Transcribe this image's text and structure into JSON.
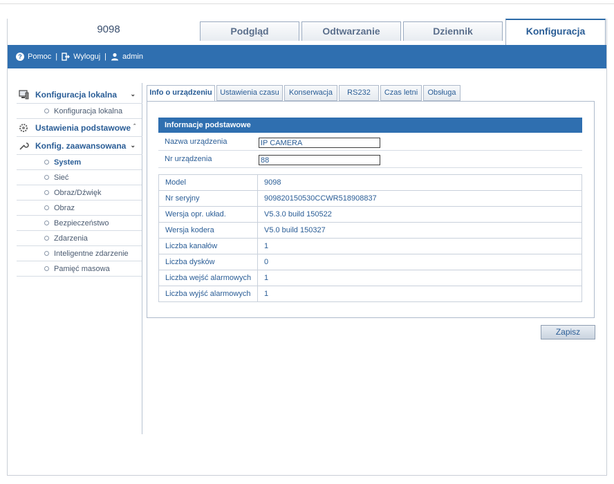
{
  "header": {
    "device_name": "9098",
    "tabs": [
      {
        "label": "Podgląd",
        "active": false
      },
      {
        "label": "Odtwarzanie",
        "active": false
      },
      {
        "label": "Dziennik",
        "active": false
      },
      {
        "label": "Konfiguracja",
        "active": true
      }
    ]
  },
  "toolbar": {
    "help": "Pomoc",
    "logout": "Wyloguj",
    "user": "admin",
    "separator": "|"
  },
  "sidebar": {
    "sections": [
      {
        "label": "Konfiguracja lokalna",
        "icon": "computer-icon",
        "expanded": true,
        "items": [
          {
            "label": "Konfiguracja lokalna"
          }
        ]
      },
      {
        "label": "Ustawienia podstawowe",
        "icon": "gear-icon",
        "expanded": false,
        "items": []
      },
      {
        "label": "Konfig. zaawansowana",
        "icon": "wrench-icon",
        "expanded": true,
        "items": [
          {
            "label": "System",
            "active": true
          },
          {
            "label": "Sieć"
          },
          {
            "label": "Obraz/Dźwięk"
          },
          {
            "label": "Obraz"
          },
          {
            "label": "Bezpieczeństwo"
          },
          {
            "label": "Zdarzenia"
          },
          {
            "label": "Inteligentne zdarzenie"
          },
          {
            "label": "Pamięć masowa"
          }
        ]
      }
    ]
  },
  "subtabs": [
    {
      "label": "Info o urządzeniu",
      "active": true
    },
    {
      "label": "Ustawienia czasu"
    },
    {
      "label": "Konserwacja"
    },
    {
      "label": "RS232"
    },
    {
      "label": "Czas letni"
    },
    {
      "label": "Obsługa"
    }
  ],
  "panel": {
    "title": "Informacje podstawowe",
    "fields": [
      {
        "label": "Nazwa urządzenia",
        "value": "IP CAMERA"
      },
      {
        "label": "Nr urządzenia",
        "value": "88"
      }
    ],
    "info": [
      {
        "label": "Model",
        "value": "9098"
      },
      {
        "label": "Nr seryjny",
        "value": "909820150530CCWR518908837"
      },
      {
        "label": "Wersja opr. układ.",
        "value": "V5.3.0 build 150522"
      },
      {
        "label": "Wersja kodera",
        "value": "V5.0 build 150327"
      },
      {
        "label": "Liczba kanałów",
        "value": "1"
      },
      {
        "label": "Liczba dysków",
        "value": "0"
      },
      {
        "label": "Liczba wejść alarmowych",
        "value": "1"
      },
      {
        "label": "Liczba wyjść alarmowych",
        "value": "1"
      }
    ]
  },
  "save_label": "Zapisz",
  "colors": {
    "accent": "#2f6fb0",
    "text": "#2a5d96"
  }
}
